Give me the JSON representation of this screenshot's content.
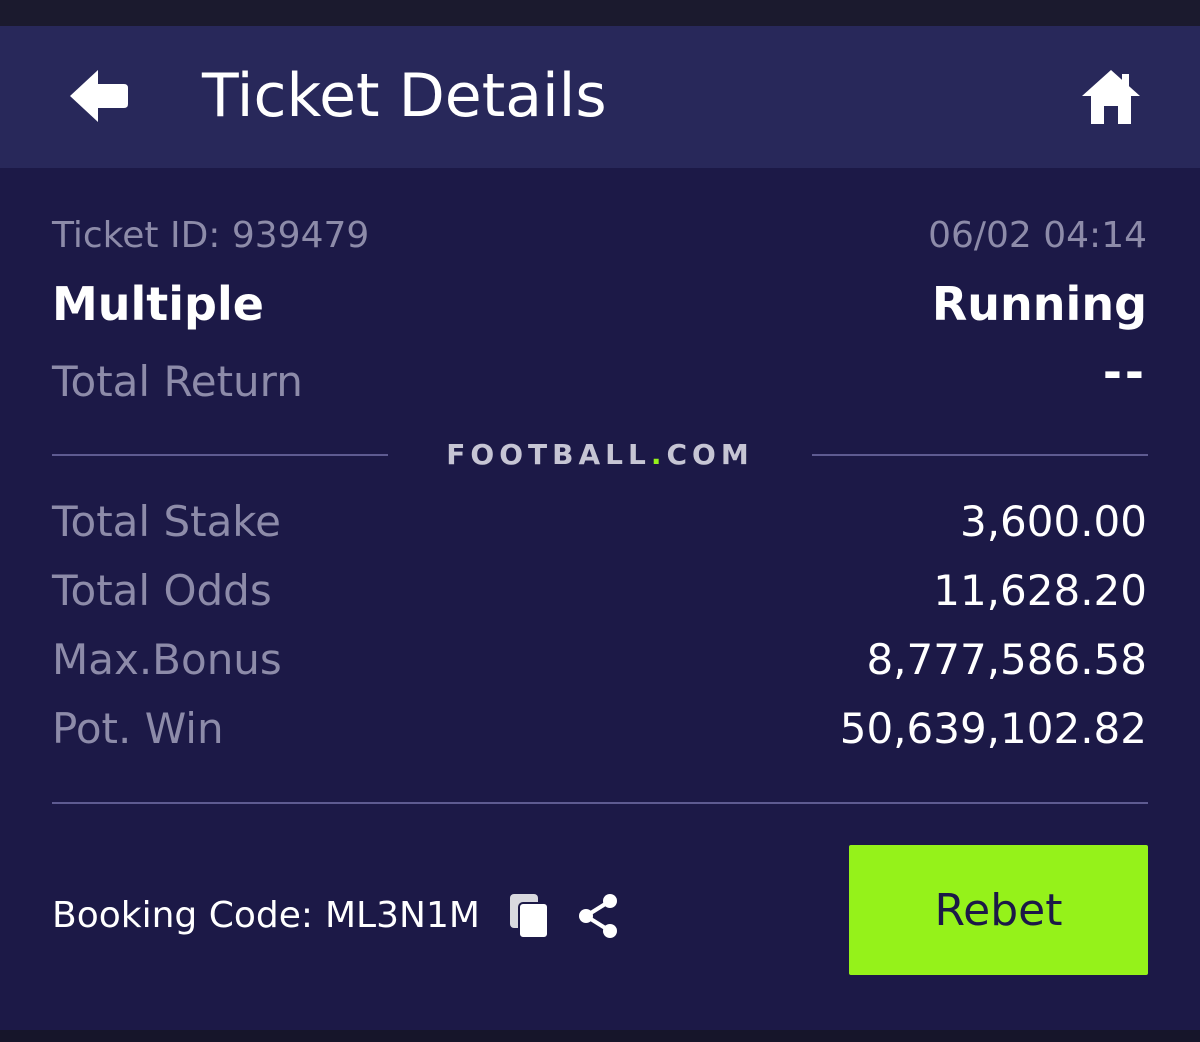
{
  "header": {
    "title": "Ticket Details",
    "back_icon": "back-arrow-icon",
    "home_icon": "home-icon"
  },
  "ticket": {
    "id_label": "Ticket ID: 939479",
    "datetime": "06/02 04:14",
    "type": "Multiple",
    "status": "Running",
    "total_return_label": "Total Return",
    "total_return_value": "--"
  },
  "logo": {
    "left": "FOOTBALL",
    "dot": ".",
    "right": "COM"
  },
  "summary": [
    {
      "label": "Total Stake",
      "value": "3,600.00"
    },
    {
      "label": "Total Odds",
      "value": "11,628.20"
    },
    {
      "label": "Max.Bonus",
      "value": "8,777,586.58"
    },
    {
      "label": "Pot. Win",
      "value": "50,639,102.82"
    }
  ],
  "booking": {
    "label": "Booking Code:",
    "code": "ML3N1M",
    "copy_icon": "copy-icon",
    "share_icon": "share-icon"
  },
  "actions": {
    "rebet_label": "Rebet"
  },
  "colors": {
    "background": "#1c1947",
    "header": "#28285a",
    "muted_text": "#8d8ba9",
    "accent_green": "#95f21a",
    "divider": "#5e5b91"
  }
}
